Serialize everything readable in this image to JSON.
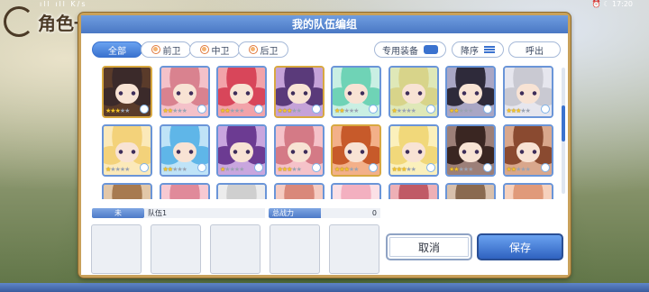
{
  "status_bar": {
    "left_text": "ıll  ıll  K/s",
    "right_text": "⏰ ☾ 17:20"
  },
  "screen_title": "角色一",
  "dialog": {
    "title": "我的队伍编组",
    "tabs": [
      {
        "label": "全部",
        "active": true
      },
      {
        "label": "前卫",
        "active": false
      },
      {
        "label": "中卫",
        "active": false
      },
      {
        "label": "后卫",
        "active": false
      }
    ],
    "equip_label": "专用装备",
    "sort_label": "降序",
    "summon_label": "呼出",
    "roster": [
      {
        "stars": 3,
        "hair": "#3b2a2a",
        "bg": "#5a3b2a",
        "gold": true
      },
      {
        "stars": 2,
        "hair": "#d9828f",
        "bg": "#f4c1c9",
        "gold": false
      },
      {
        "stars": 2,
        "hair": "#d8465a",
        "bg": "#f2a3a9",
        "gold": false
      },
      {
        "stars": 3,
        "hair": "#5a3a7a",
        "bg": "#c5a2d8",
        "gold": true
      },
      {
        "stars": 2,
        "hair": "#6fd3b6",
        "bg": "#c9efe3",
        "gold": false
      },
      {
        "stars": 1,
        "hair": "#d8d48a",
        "bg": "#dfe8b8",
        "gold": false
      },
      {
        "stars": 2,
        "hair": "#2e2a3a",
        "bg": "#a9a6c4",
        "gold": false
      },
      {
        "stars": 3,
        "hair": "#c9c9d2",
        "bg": "#e6e6ee",
        "gold": false
      },
      {
        "stars": 1,
        "hair": "#f3d27a",
        "bg": "#fbe9b9",
        "gold": false
      },
      {
        "stars": 2,
        "hair": "#5fb6e8",
        "bg": "#bfe3f7",
        "gold": false
      },
      {
        "stars": 1,
        "hair": "#6c3b92",
        "bg": "#c9a6de",
        "gold": false
      },
      {
        "stars": 3,
        "hair": "#d47a86",
        "bg": "#f5c2c9",
        "gold": false
      },
      {
        "stars": 3,
        "hair": "#c75a2a",
        "bg": "#f3b089",
        "gold": true
      },
      {
        "stars": 3,
        "hair": "#f1d87a",
        "bg": "#fbf0bc",
        "gold": false
      },
      {
        "stars": 2,
        "hair": "#3a2622",
        "bg": "#9c7f78",
        "gold": false
      },
      {
        "stars": 2,
        "hair": "#8a4a30",
        "bg": "#d9a78c",
        "gold": false
      },
      {
        "stars": 0,
        "hair": "#a77a50",
        "bg": "#e2c7a8",
        "gold": false
      },
      {
        "stars": 0,
        "hair": "#e08a9a",
        "bg": "#f7c9d2",
        "gold": false
      },
      {
        "stars": 0,
        "hair": "#cfcfcf",
        "bg": "#ececec",
        "gold": false
      },
      {
        "stars": 0,
        "hair": "#d9887a",
        "bg": "#f5cbc2",
        "gold": false
      },
      {
        "stars": 0,
        "hair": "#f3b0c0",
        "bg": "#fbe0e6",
        "gold": false
      },
      {
        "stars": 0,
        "hair": "#c05a66",
        "bg": "#eeb0b6",
        "gold": false
      },
      {
        "stars": 0,
        "hair": "#8a6a50",
        "bg": "#d8c0ac",
        "gold": false
      },
      {
        "stars": 0,
        "hair": "#e09a7a",
        "bg": "#f6d1bd",
        "gold": false
      }
    ],
    "party": {
      "level_tag": "未",
      "name": "队伍1",
      "power_label": "总战力",
      "power_value": "0",
      "slots": 5
    },
    "cancel_label": "取消",
    "save_label": "保存"
  },
  "colors": {
    "accent": "#3a72cf",
    "frame": "#c9a15a",
    "star": "#f3c32b"
  },
  "icons": [
    "rank-badge-icon",
    "equipment-toggle-icon",
    "sort-icon",
    "star-icon"
  ]
}
